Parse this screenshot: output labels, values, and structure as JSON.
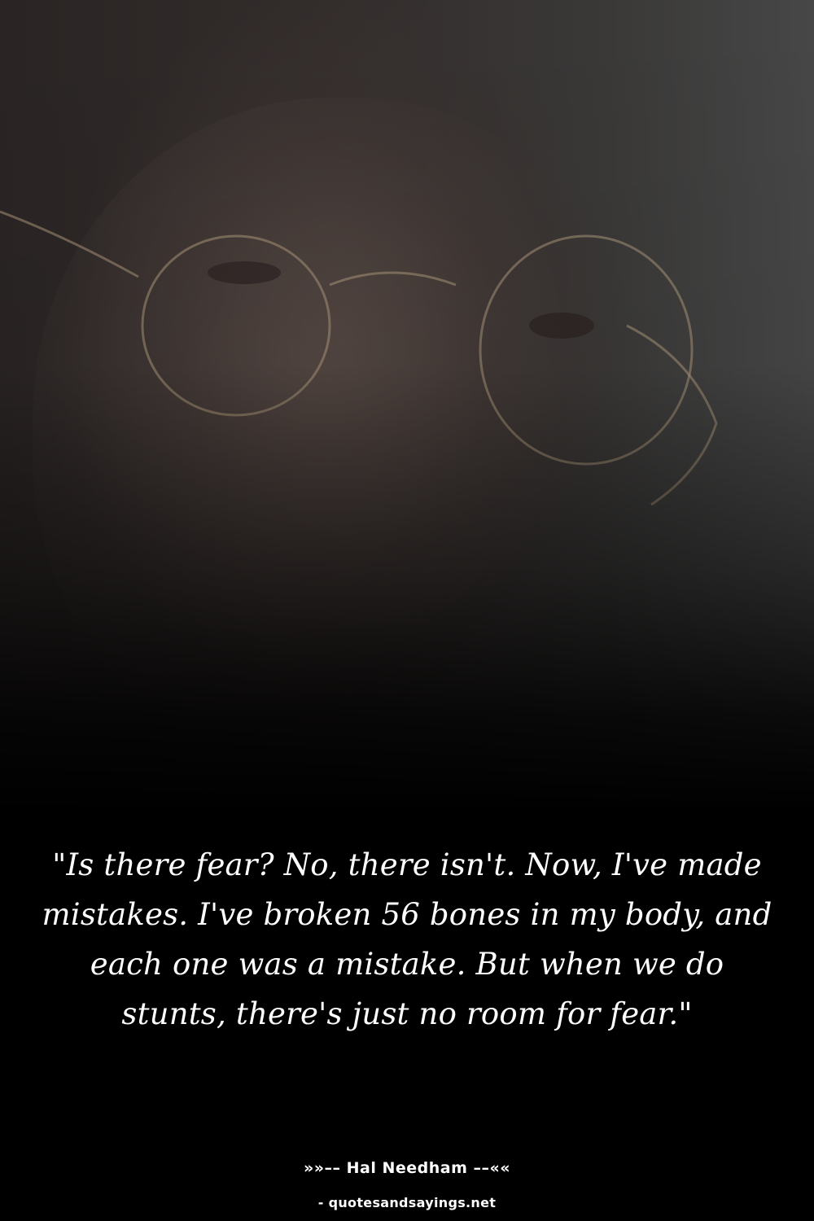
{
  "quote": {
    "text": "\"Is there fear? No, there isn't. Now, I've made mistakes. I've broken 56 bones in my body, and each one was a mistake. But when we do stunts, there's just no room for fear.\""
  },
  "attribution": {
    "author_line": "»»–– Hal Needham ––««"
  },
  "source": {
    "site": "- quotesandsayings.net"
  },
  "colors": {
    "background": "#000000",
    "text": "#ffffff"
  }
}
